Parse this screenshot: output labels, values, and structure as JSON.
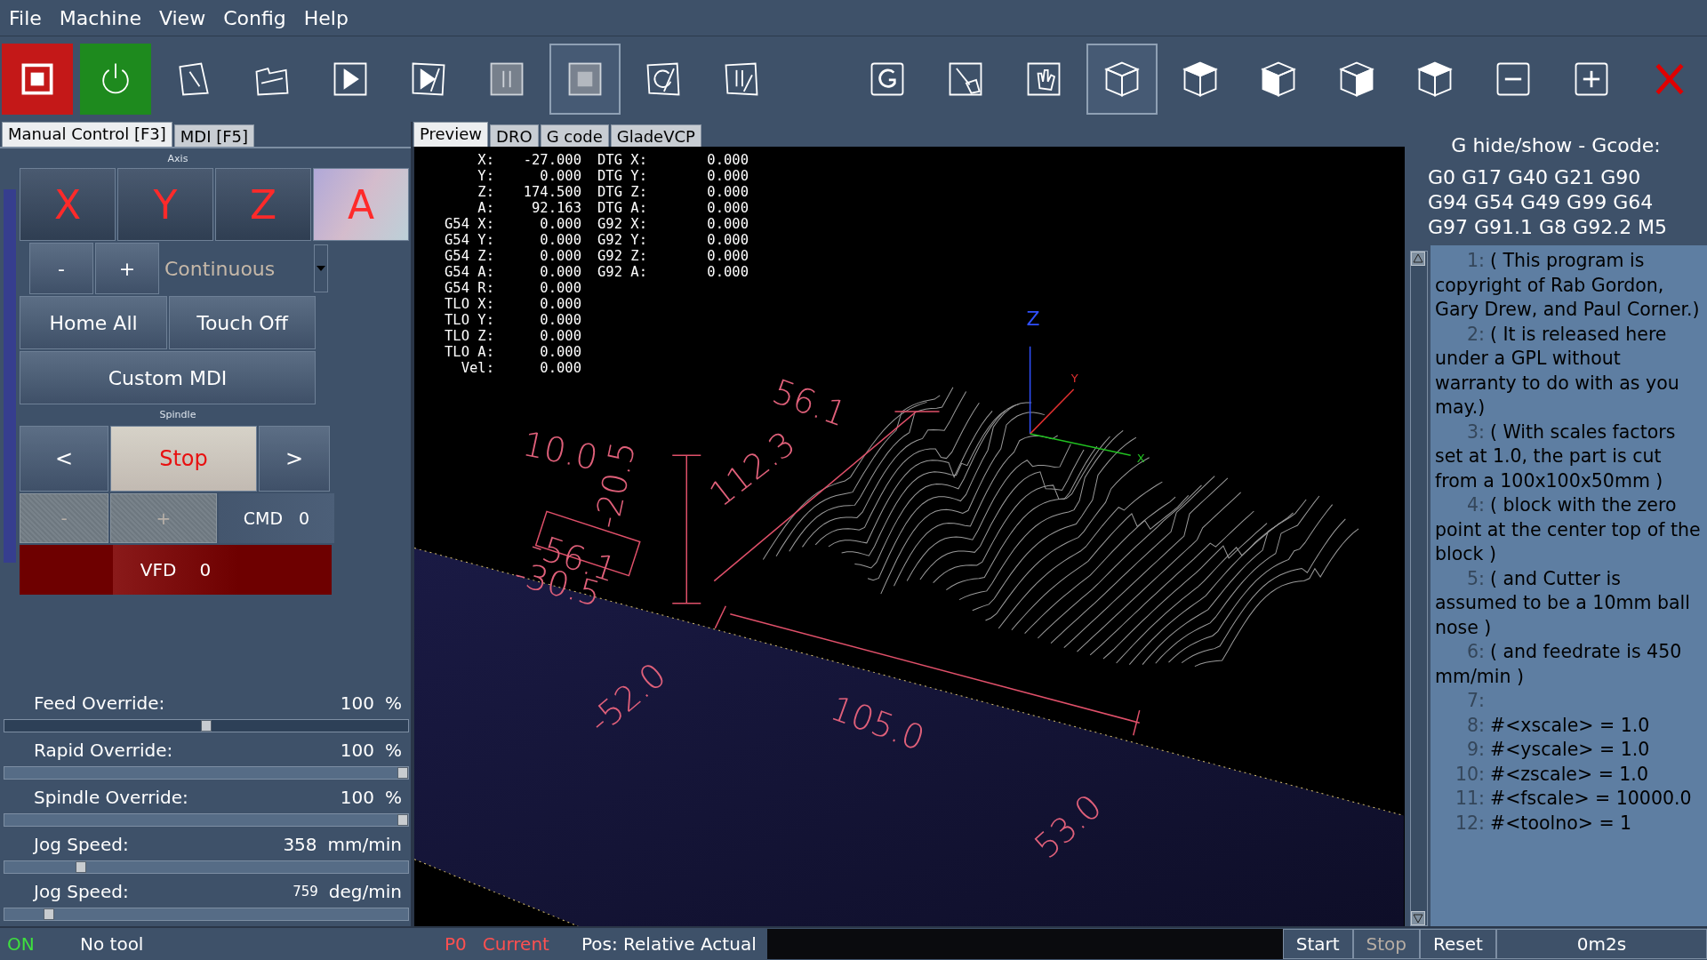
{
  "menu": [
    "File",
    "Machine",
    "View",
    "Config",
    "Help"
  ],
  "toolbar": [
    {
      "kind": "estop",
      "selected": false,
      "disabled": false
    },
    {
      "kind": "power",
      "selected": false,
      "disabled": false
    },
    {
      "kind": "open",
      "selected": false,
      "disabled": false
    },
    {
      "kind": "reload",
      "selected": false,
      "disabled": false
    },
    {
      "kind": "run",
      "selected": false,
      "disabled": false
    },
    {
      "kind": "step",
      "selected": false,
      "disabled": false
    },
    {
      "kind": "pause",
      "selected": false,
      "disabled": true
    },
    {
      "kind": "stop",
      "selected": true,
      "disabled": true
    },
    {
      "kind": "rerun",
      "selected": false,
      "disabled": false
    },
    {
      "kind": "optional-stop",
      "selected": false,
      "disabled": false
    },
    {
      "kind": "gcode",
      "selected": false,
      "disabled": false
    },
    {
      "kind": "clear",
      "selected": false,
      "disabled": false
    },
    {
      "kind": "touch",
      "selected": false,
      "disabled": false
    },
    {
      "kind": "view-iso",
      "selected": true,
      "disabled": false
    },
    {
      "kind": "view-top",
      "selected": false,
      "disabled": false
    },
    {
      "kind": "view-front",
      "selected": false,
      "disabled": false
    },
    {
      "kind": "view-side",
      "selected": false,
      "disabled": false
    },
    {
      "kind": "view-corner",
      "selected": false,
      "disabled": false
    },
    {
      "kind": "zoom-out",
      "selected": false,
      "disabled": false
    },
    {
      "kind": "zoom-in",
      "selected": false,
      "disabled": false
    },
    {
      "kind": "exit",
      "selected": false,
      "disabled": false
    }
  ],
  "left_tabs": [
    {
      "label": "Manual Control [F3]",
      "selected": true
    },
    {
      "label": "MDI [F5]",
      "selected": false
    }
  ],
  "axis_section": {
    "title": "Axis",
    "axes": [
      {
        "label": "X",
        "selected": false
      },
      {
        "label": "Y",
        "selected": false
      },
      {
        "label": "Z",
        "selected": false
      },
      {
        "label": "A",
        "selected": true
      }
    ],
    "jog_minus": "-",
    "jog_plus": "+",
    "jog_mode": "Continuous",
    "home_all": "Home All",
    "touch_off": "Touch Off",
    "custom_mdi": "Custom MDI"
  },
  "spindle_section": {
    "title": "Spindle",
    "buttons": [
      {
        "label": "<",
        "selected": false
      },
      {
        "label": "Stop",
        "selected": true
      },
      {
        "label": ">",
        "selected": false
      }
    ],
    "speed_buttons": [
      {
        "label": "-",
        "disabled": true
      },
      {
        "label": "+",
        "disabled": true
      }
    ],
    "cmd_label": "CMD",
    "cmd_value": "0",
    "vfd_label": "VFD",
    "vfd_value": "0"
  },
  "overrides": [
    {
      "label": "Feed Override:",
      "value": "100",
      "unit": "%",
      "level": 0.5
    },
    {
      "label": "Rapid Override:",
      "value": "100",
      "unit": "%",
      "level": 1
    },
    {
      "label": "Spindle Override:",
      "value": "100",
      "unit": "%",
      "level": 1
    },
    {
      "label": "Jog Speed:",
      "value": "358",
      "unit": "mm/min",
      "level": 0.18
    },
    {
      "label": "Jog Speed:",
      "value": "759",
      "unit": "deg/min",
      "level": 0.1
    }
  ],
  "preview_tabs": [
    {
      "label": "Preview",
      "selected": true
    },
    {
      "label": "DRO",
      "selected": false
    },
    {
      "label": "G code",
      "selected": false
    },
    {
      "label": "GladeVCP",
      "selected": false
    }
  ],
  "dro": [
    {
      "label": "X:",
      "value": "-27.000",
      "label_2": "DTG X:",
      "value_2": "0.000"
    },
    {
      "label": "Y:",
      "value": "0.000",
      "label_2": "DTG Y:",
      "value_2": "0.000"
    },
    {
      "label": "Z:",
      "value": "174.500",
      "label_2": "DTG Z:",
      "value_2": "0.000"
    },
    {
      "label": "A:",
      "value": "92.163",
      "label_2": "DTG A:",
      "value_2": "0.000"
    },
    {
      "label": "G54 X:",
      "value": "0.000",
      "label_2": "G92 X:",
      "value_2": "0.000"
    },
    {
      "label": "G54 Y:",
      "value": "0.000",
      "label_2": "G92 Y:",
      "value_2": "0.000"
    },
    {
      "label": "G54 Z:",
      "value": "0.000",
      "label_2": "G92 Z:",
      "value_2": "0.000"
    },
    {
      "label": "G54 A:",
      "value": "0.000",
      "label_2": "G92 A:",
      "value_2": "0.000"
    },
    {
      "label": "G54 R:",
      "value": "0.000"
    },
    {
      "label": "TLO X:",
      "value": "0.000"
    },
    {
      "label": "TLO Y:",
      "value": "0.000"
    },
    {
      "label": "TLO Z:",
      "value": "0.000"
    },
    {
      "label": "TLO A:",
      "value": "0.000"
    },
    {
      "label": "Vel:",
      "value": "0.000"
    }
  ],
  "plot_labels": [
    "10.0",
    "56.1",
    "112.3",
    "-56.1",
    "-20.5",
    "-30.5",
    "-52.0",
    "105.0",
    "53.0"
  ],
  "axis_labels": [
    "Z",
    "Y",
    "X"
  ],
  "gcode_panel": {
    "title": "G hide/show - Gcode:",
    "modal_lines": [
      "G0 G17 G40 G21 G90",
      "G94 G54 G49 G99 G64",
      "G97 G91.1 G8 G92.2 M5"
    ],
    "program": [
      {
        "number": "1:",
        "text": "( This program is copyright of Rab Gordon, Gary Drew, and Paul Corner.)"
      },
      {
        "number": "2:",
        "text": "( It is released here under a GPL without warranty to do with as you may.)"
      },
      {
        "number": "3:",
        "text": "( With scales factors set at 1.0, the part is cut from a 100x100x50mm )"
      },
      {
        "number": "4:",
        "text": "( block with the zero point at the center top of the block )"
      },
      {
        "number": "5:",
        "text": "( and Cutter is assumed to be a 10mm ball nose )"
      },
      {
        "number": "6:",
        "text": "( and feedrate is 450 mm/min )"
      },
      {
        "number": "7:"
      },
      {
        "number": "8:",
        "text": "#<xscale> = 1.0"
      },
      {
        "number": "9:",
        "text": "#<yscale> = 1.0"
      },
      {
        "number": "10:",
        "text": "#<zscale> = 1.0"
      },
      {
        "number": "11:",
        "text": "#<fscale> = 10000.0"
      },
      {
        "number": "12:",
        "text": "#<toolno> = 1"
      }
    ]
  },
  "status_bar": {
    "machine_state": "ON",
    "tool": "No tool",
    "offset": "P0",
    "offset_state": "Current",
    "position": "Pos: Relative Actual",
    "buttons": [
      {
        "label": "Start",
        "disabled": false
      },
      {
        "label": "Stop",
        "disabled": true
      },
      {
        "label": "Reset",
        "disabled": false
      }
    ],
    "run_time": "0m2s"
  }
}
